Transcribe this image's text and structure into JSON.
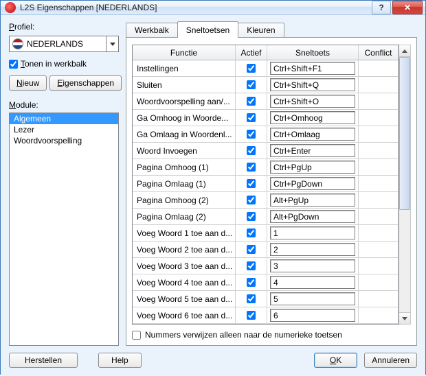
{
  "window": {
    "title": "L2S Eigenschappen [NEDERLANDS]"
  },
  "left": {
    "profile_label": "Profiel:",
    "profile_underline": "P",
    "profile_value": "NEDERLANDS",
    "toolbar_check_underline": "T",
    "toolbar_check_rest": "onen in werkbalk",
    "btn_new_underline": "N",
    "btn_new_rest": "ieuw",
    "btn_props_underline": "E",
    "btn_props_rest": "igenschappen",
    "module_label": "Module:",
    "module_label_underline": "M",
    "modules": [
      {
        "label": "Algemeen",
        "selected": true
      },
      {
        "label": "Lezer",
        "selected": false
      },
      {
        "label": "Woordvoorspelling",
        "selected": false
      }
    ]
  },
  "tabs": {
    "t1": "Werkbalk",
    "t2": "Sneltoetsen",
    "t3": "Kleuren"
  },
  "grid": {
    "h_function": "Functie",
    "h_active": "Actief",
    "h_shortcut": "Sneltoets",
    "h_conflict": "Conflict",
    "rows": [
      {
        "fn": "Instellingen",
        "key": "Ctrl+Shift+F1"
      },
      {
        "fn": "Sluiten",
        "key": "Ctrl+Shift+Q"
      },
      {
        "fn": "Woordvoorspelling aan/...",
        "key": "Ctrl+Shift+O"
      },
      {
        "fn": "Ga Omhoog in Woorde...",
        "key": "Ctrl+Omhoog"
      },
      {
        "fn": "Ga Omlaag in Woordenl...",
        "key": "Ctrl+Omlaag"
      },
      {
        "fn": "Woord Invoegen",
        "key": "Ctrl+Enter"
      },
      {
        "fn": "Pagina Omhoog (1)",
        "key": "Ctrl+PgUp"
      },
      {
        "fn": "Pagina Omlaag (1)",
        "key": "Ctrl+PgDown"
      },
      {
        "fn": "Pagina Omhoog (2)",
        "key": "Alt+PgUp"
      },
      {
        "fn": "Pagina Omlaag (2)",
        "key": "Alt+PgDown"
      },
      {
        "fn": "Voeg Woord 1 toe aan d...",
        "key": "1"
      },
      {
        "fn": "Voeg Woord 2 toe aan d...",
        "key": "2"
      },
      {
        "fn": "Voeg Woord 3 toe aan d...",
        "key": "3"
      },
      {
        "fn": "Voeg Woord 4 toe aan d...",
        "key": "4"
      },
      {
        "fn": "Voeg Woord 5 toe aan d...",
        "key": "5"
      },
      {
        "fn": "Voeg Woord 6 toe aan d...",
        "key": "6"
      }
    ],
    "numcheck": "Nummers verwijzen alleen naar de numerieke toetsen"
  },
  "footer": {
    "restore": "Herstellen",
    "help": "Help",
    "ok": "OK",
    "cancel": "Annuleren"
  }
}
